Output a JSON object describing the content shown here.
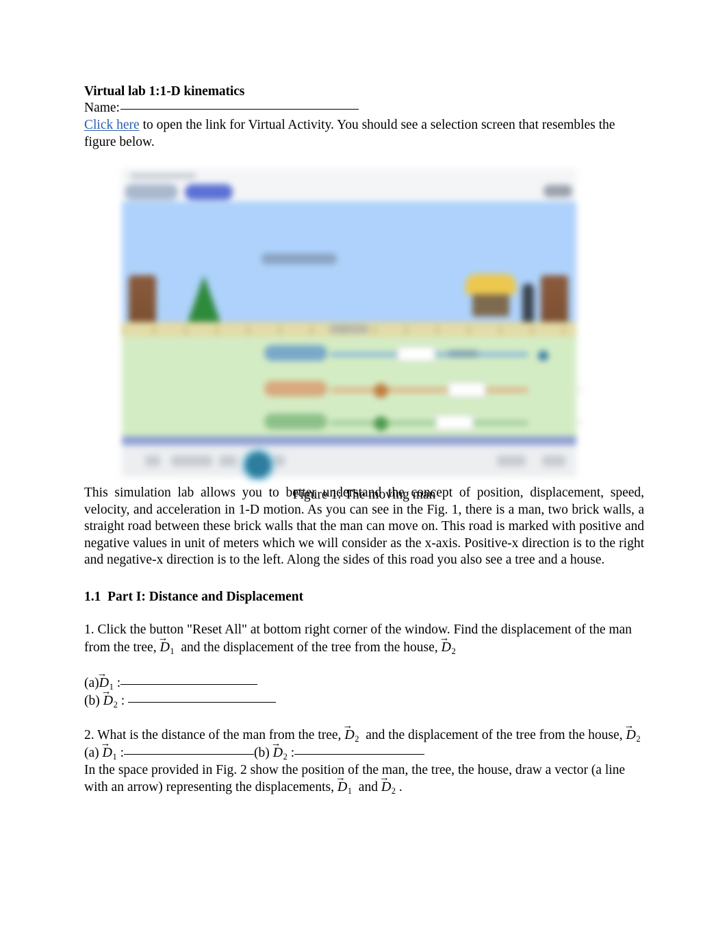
{
  "document": {
    "title": "Virtual lab 1:1-D kinematics",
    "name_label": "Name:",
    "intro": {
      "link_text": "Click here",
      "after_link": " to open the link for Virtual Activity. You should see a selection screen that resembles the figure below."
    },
    "figure": {
      "caption": "Figure 1: The moving man",
      "alt": "blurred screenshot of the Moving Man simulation"
    },
    "description_para": "This simulation lab allows you to better understand the concept of position, displacement, speed, velocity, and acceleration in 1-D motion. As you can see in the Fig. 1, there is a man, two brick walls, a straight road between these brick walls that the man can move on. This road is marked with positive and negative values in unit of meters which we will consider as the x-axis. Positive-x direction is to the right and negative-x direction is to the left. Along the sides of this road you also see a tree and a house.",
    "section": {
      "number": "1.1",
      "title": "Part I: Distance and Displacement"
    },
    "q1": {
      "part_1": "1. Click the button \"Reset All\" at bottom right corner of the window. Find the displacement of the man from the tree,",
      "part_2": "and the displacement of the tree from the house,",
      "answers": [
        {
          "label": "(a)",
          "symbol": "D",
          "sub": "1",
          "colon": ":"
        },
        {
          "label": "(b)",
          "symbol": "D",
          "sub": "2",
          "colon": ":"
        }
      ]
    },
    "q2": {
      "part_1": "2. What is the distance of the man from the tree,",
      "part_2": "and the displacement of the tree from the",
      "part_3": "house,",
      "answer_a_label": "(a)",
      "answer_b_label": "(b)",
      "colon": ":"
    },
    "closing": {
      "part_1": "In the space provided in Fig. 2 show the position of the man, the tree, the  house, draw a vector (a line with an arrow) representing the displacements,",
      "part_2": "and",
      "period": "."
    },
    "symbols": {
      "arrow": "→",
      "D": "D",
      "sub1": "1",
      "sub2": "2"
    },
    "colors": {
      "link": "#2a5db0",
      "sky": "#aed2fb",
      "ground": "#d4ecc4",
      "road": "#e3dca8",
      "brick": "#8a5a3b",
      "tree": "#2f8a3c",
      "house_roof": "#edc84f",
      "position_slider": "#3b7fa8",
      "velocity_slider": "#c07d3f",
      "acceleration_slider": "#4f9a4f",
      "toolbar": "#eceef0"
    }
  }
}
